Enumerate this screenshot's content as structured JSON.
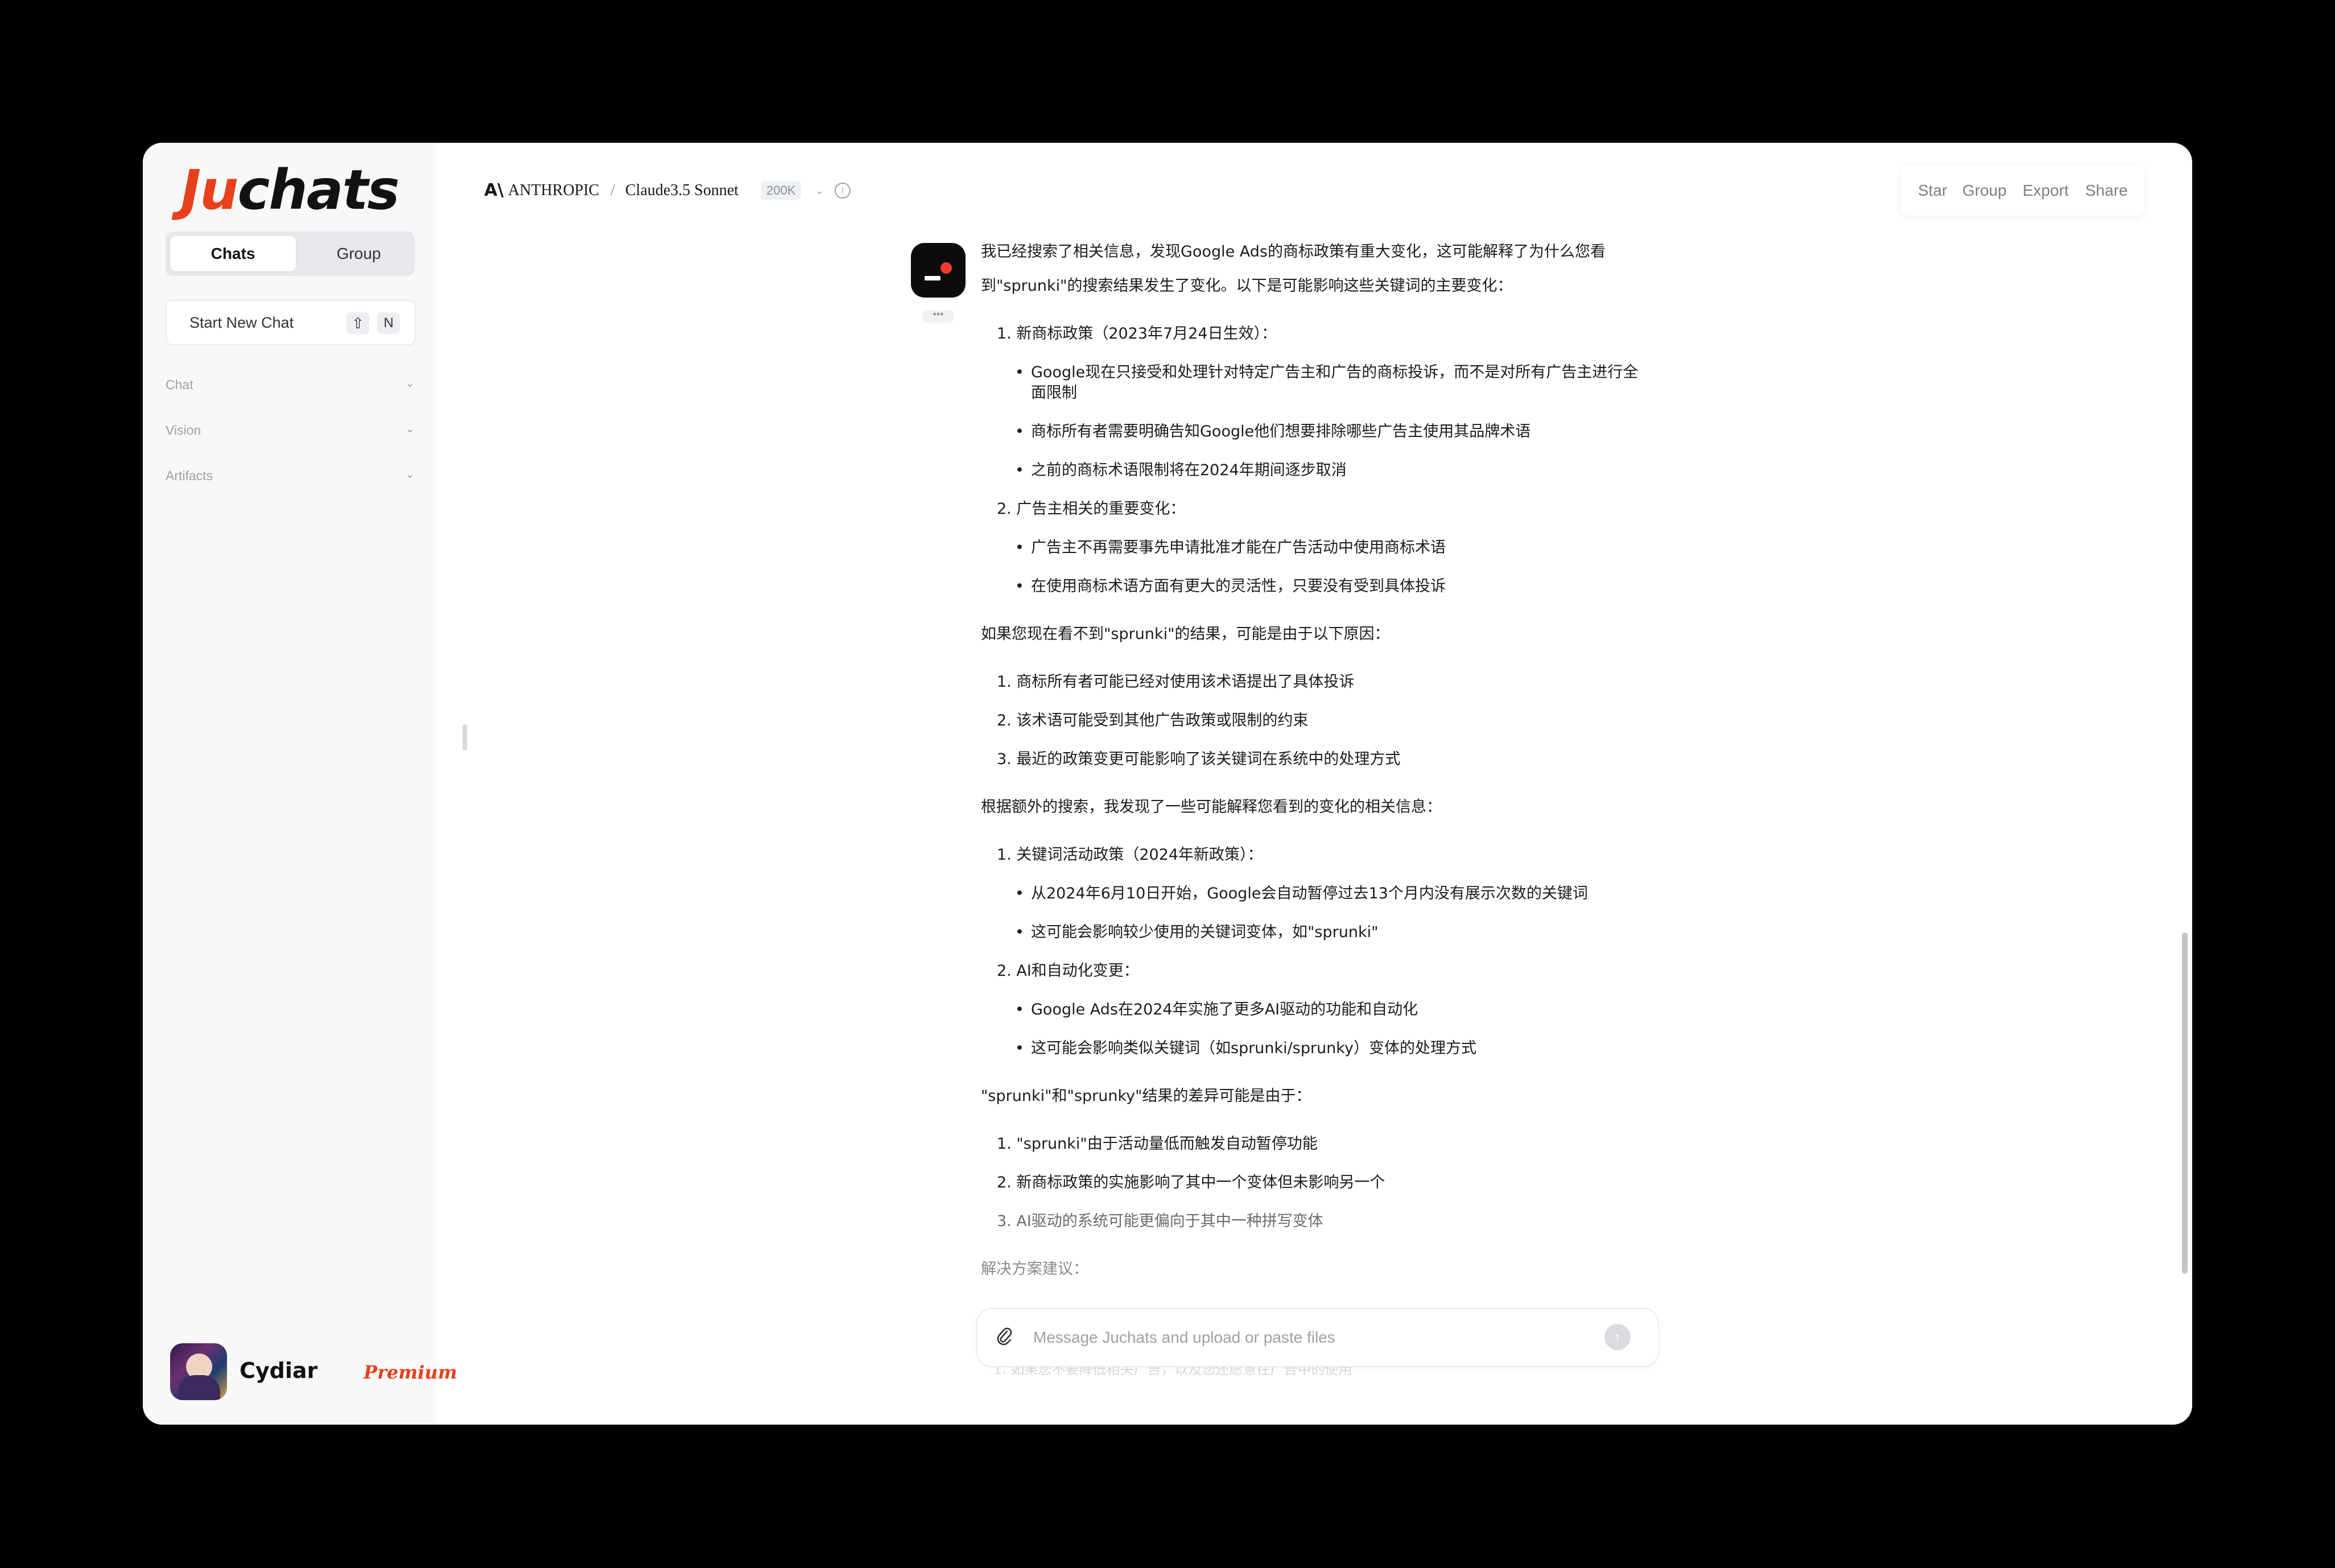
{
  "sidebar": {
    "logo": {
      "part1": "Ju",
      "part2": "chats"
    },
    "tabs": {
      "chats": "Chats",
      "group": "Group"
    },
    "new_chat": {
      "label": "Start New Chat",
      "shortcut_shift": "⇧",
      "shortcut_key": "N"
    },
    "sections": [
      {
        "label": "Chat",
        "chevron": "⌄"
      },
      {
        "label": "Vision",
        "chevron": "⌄"
      },
      {
        "label": "Artifacts",
        "chevron": "⌄"
      }
    ],
    "user": {
      "name": "Cydiar",
      "badge": "Premium"
    }
  },
  "header": {
    "provider_icon": "A\\",
    "provider": "ANTHROPIC",
    "separator": "/",
    "model": "Claude3.5 Sonnet",
    "context": "200K",
    "chevron": "⌄",
    "info": "i",
    "actions": {
      "star": "Star",
      "group": "Group",
      "export": "Export",
      "share": "Share"
    }
  },
  "message": {
    "more": "•••",
    "lines": [
      "我已经搜索了相关信息，发现Google Ads的商标政策有重大变化，这可能解释了为什么您看",
      "到\"sprunki\"的搜索结果发生了变化。以下是可能影响这些关键词的主要变化：",
      "1. 新商标政策（2023年7月24日生效）：",
      "Google现在只接受和处理针对特定广告主和广告的商标投诉，而不是对所有广告主进行全",
      "面限制",
      "商标所有者需要明确告知Google他们想要排除哪些广告主使用其品牌术语",
      "之前的商标术语限制将在2024年期间逐步取消",
      "2. 广告主相关的重要变化：",
      "广告主不再需要事先申请批准才能在广告活动中使用商标术语",
      "在使用商标术语方面有更大的灵活性，只要没有受到具体投诉",
      "如果您现在看不到\"sprunki\"的结果，可能是由于以下原因：",
      "1. 商标所有者可能已经对使用该术语提出了具体投诉",
      "2. 该术语可能受到其他广告政策或限制的约束",
      "3. 最近的政策变更可能影响了该关键词在系统中的处理方式",
      "根据额外的搜索，我发现了一些可能解释您看到的变化的相关信息：",
      "1. 关键词活动政策（2024年新政策）：",
      "从2024年6月10日开始，Google会自动暂停过去13个月内没有展示次数的关键词",
      "这可能会影响较少使用的关键词变体，如\"sprunki\"",
      "2. AI和自动化变更：",
      "Google Ads在2024年实施了更多AI驱动的功能和自动化",
      "这可能会影响类似关键词（如sprunki/sprunky）变体的处理方式",
      "\"sprunki\"和\"sprunky\"结果的差异可能是由于：",
      "1. \"sprunki\"由于活动量低而触发自动暂停功能",
      "2. 新商标政策的实施影响了其中一个变体但未影响另一个",
      "3. AI驱动的系统可能更偏向于其中一种拼写变体",
      "解决方案建议："
    ],
    "ghost": "1. 如果您不要降低相关广告，以及您还愿意在广告中的使用"
  },
  "composer": {
    "attach_icon": "paperclip-icon",
    "placeholder": "Message Juchats and upload or paste files",
    "value": "",
    "send_icon": "↑"
  },
  "colors": {
    "brand": "#e8401c",
    "window_bg": "#ffffff",
    "sidebar_bg": "#f8f8f9"
  }
}
